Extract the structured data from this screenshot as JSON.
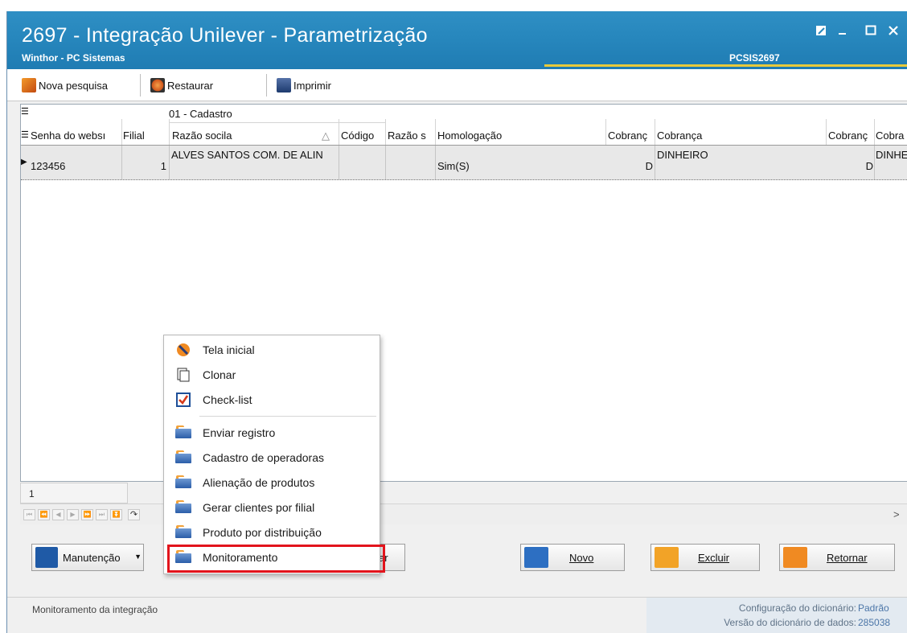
{
  "window": {
    "title": "2697 - Integração Unilever - Parametrização",
    "subtitle": "Winthor - PC Sistemas",
    "code": "PCSIS2697",
    "controls": [
      "restore-icon",
      "minimize-icon",
      "maximize-icon",
      "close-icon"
    ]
  },
  "toolbar": {
    "nova_pesquisa": "Nova pesquisa",
    "restaurar": "Restaurar",
    "imprimir": "Imprimir"
  },
  "grid": {
    "group_header": "01 - Cadastro",
    "columns": [
      "Senha do websı",
      "Filial",
      "Razão socila",
      "Código",
      "Razão s",
      "Homologação",
      "Cobranç",
      "Cobrança",
      "Cobranç",
      "Cobra"
    ],
    "sort_indicator": "△",
    "rows": [
      {
        "senha": "123456",
        "filial": "1",
        "razao": "ALVES SANTOS COM. DE ALIN",
        "codigo": "",
        "razao_s": "",
        "homologacao": "Sim(S)",
        "cobranca_cod": "D",
        "cobranca": "DINHEIRO",
        "cobranca_cod2": "D",
        "cobranca2": "DINHE"
      }
    ]
  },
  "navigator": {
    "page": "1",
    "scroll_right": ">"
  },
  "context_menu": {
    "items": [
      {
        "label": "Tela inicial",
        "icon": "home-icon"
      },
      {
        "label": "Clonar",
        "icon": "clone-icon"
      },
      {
        "label": "Check-list",
        "icon": "checklist-icon"
      },
      {
        "label": "Enviar registro",
        "icon": "folder-icon"
      },
      {
        "label": "Cadastro de operadoras",
        "icon": "folder-icon"
      },
      {
        "label": "Alienação de produtos",
        "icon": "folder-icon"
      },
      {
        "label": "Gerar clientes por filial",
        "icon": "folder-icon"
      },
      {
        "label": "Produto por distribuição",
        "icon": "folder-icon"
      },
      {
        "label": "Monitoramento",
        "icon": "folder-icon"
      }
    ],
    "highlight_color": "#e2141c"
  },
  "buttons": {
    "manutencao": "Manutenção",
    "partial": "ar",
    "novo": "Novo",
    "excluir": "Excluir",
    "retornar": "Retornar"
  },
  "status": {
    "hint": "Monitoramento da integração",
    "config_label": "Configuração do dicionário:",
    "config_value": "Padrão",
    "version_label": "Versão do dicionário de dados:",
    "version_value": "285038"
  },
  "colors": {
    "titlebar": "#2787bd",
    "accent": "#e7c93a"
  }
}
